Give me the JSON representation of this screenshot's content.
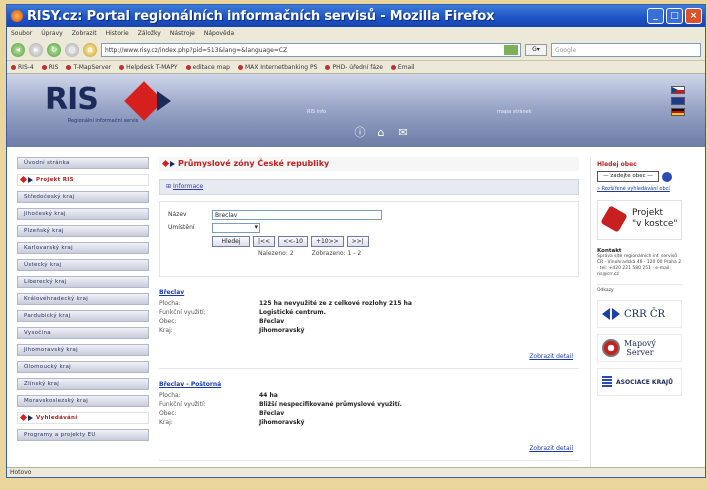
{
  "window": {
    "title": "RISY.cz: Portal regionálních informačních servisů - Mozilla Firefox",
    "status": "Hotovo"
  },
  "menubar": [
    "Soubor",
    "Úpravy",
    "Zobrazit",
    "Historie",
    "Záložky",
    "Nástroje",
    "Nápověda"
  ],
  "navbar": {
    "url": "http://www.risy.cz/index.php?pid=513&lang=&language=CZ",
    "search_placeholder": "Google"
  },
  "bookmarks": [
    "RIS-4",
    "RIS",
    "T-MapServer",
    "Helpdesk T-MAPY",
    "editace map",
    "MAX Internetbanking PS",
    "PHD- úřední fáze",
    "Email"
  ],
  "header": {
    "logo": "RIS",
    "subtitle": "Regionální informační servis",
    "link1": "RIS info",
    "link2": "mapa stránek"
  },
  "leftmenu": [
    {
      "label": "Úvodní stránka",
      "active": false
    },
    {
      "label": "Projekt RIS",
      "active": true
    },
    {
      "label": "Středočeský kraj",
      "active": false
    },
    {
      "label": "Jihočeský kraj",
      "active": false
    },
    {
      "label": "Plzeňský kraj",
      "active": false
    },
    {
      "label": "Karlovarský kraj",
      "active": false
    },
    {
      "label": "Ústecký kraj",
      "active": false
    },
    {
      "label": "Liberecký kraj",
      "active": false
    },
    {
      "label": "Královéhradecký kraj",
      "active": false
    },
    {
      "label": "Pardubický kraj",
      "active": false
    },
    {
      "label": "Vysočina",
      "active": false
    },
    {
      "label": "Jihomoravský kraj",
      "active": false
    },
    {
      "label": "Olomoucký kraj",
      "active": false
    },
    {
      "label": "Zlínský kraj",
      "active": false
    },
    {
      "label": "Moravskoslezský kraj",
      "active": false
    },
    {
      "label": "Vyhledávání",
      "active": true
    },
    {
      "label": "Programy a projekty EU",
      "active": false
    }
  ],
  "main": {
    "title": "Průmyslové zóny České republiky",
    "info_bar": "Informace",
    "form": {
      "name_label": "Název",
      "name_value": "Breclav",
      "location_label": "Umístění",
      "search_button": "Hledej",
      "btn_first": "|<<",
      "btn_prev": "<<-10",
      "btn_next": "+10>>",
      "btn_last": ">>|",
      "found_text": "Nalezeno: 2",
      "shown_text": "Zobrazeno: 1 - 2"
    },
    "results": [
      {
        "name": "Břeclav",
        "rows": [
          {
            "label": "Plocha:",
            "value": "125 ha nevyužité ze z celkové rozlohy 215 ha"
          },
          {
            "label": "Funkční využití:",
            "value": "Logistické centrum."
          },
          {
            "label": "Obec:",
            "value": "Břeclav"
          },
          {
            "label": "Kraj:",
            "value": "Jihomoravský"
          }
        ],
        "detail": "Zobrazit detail"
      },
      {
        "name": "Břeclav - Poštorná",
        "rows": [
          {
            "label": "Plocha:",
            "value": "44 ha"
          },
          {
            "label": "Funkční využití:",
            "value": "Bližší nespecifikované průmyslové využití."
          },
          {
            "label": "Obec:",
            "value": "Břeclav"
          },
          {
            "label": "Kraj:",
            "value": "Jihomoravský"
          }
        ],
        "detail": "Zobrazit detail"
      }
    ]
  },
  "rightbar": {
    "search_title": "Hledej obec",
    "select_value": "— zadejte obec —",
    "link": "» Rozšířené vyhledávání obcí",
    "projekt_line1": "Projekt",
    "projekt_line2": "\"v kostce\"",
    "contact_title": "Kontakt",
    "contact_text": "Správa sítě regionálních inf. servisů ČR · Vinohradská 46 · 120 00 Praha 2 · tel: +420 221 580 251 · e-mail: ris@crr.cz",
    "partners_title": "Odkazy",
    "partner1": "CRR ČR",
    "partner2_line1": "Mapový",
    "partner2_line2": "Server",
    "partner3": "ASOCIACE KRAJŮ"
  },
  "colors": {
    "titlebar": "#1b52c4",
    "accent_red": "#c02020",
    "link_blue": "#1b3ab0",
    "ris_navy": "#1c2a5a"
  }
}
